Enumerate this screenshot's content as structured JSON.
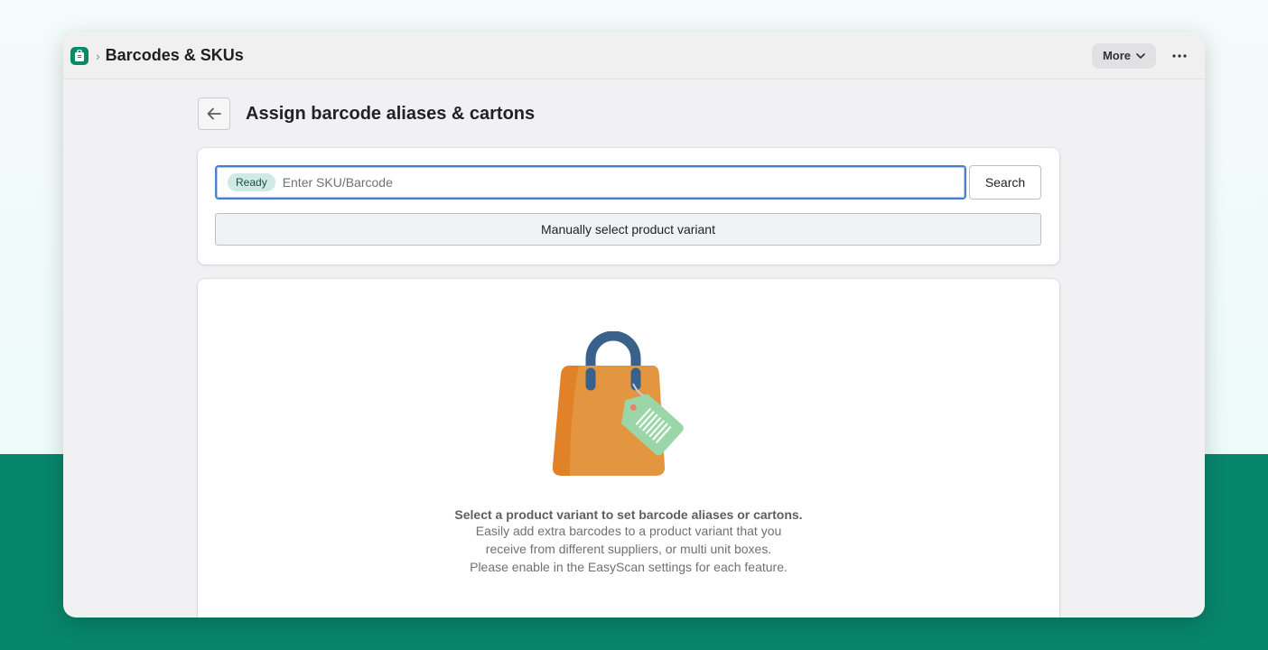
{
  "titlebar": {
    "app_title": "Barcodes & SKUs",
    "more_label": "More"
  },
  "page": {
    "title": "Assign barcode aliases & cartons"
  },
  "search": {
    "status_badge": "Ready",
    "placeholder": "Enter SKU/Barcode",
    "value": "",
    "button_label": "Search",
    "manual_select_label": "Manually select product variant"
  },
  "empty_state": {
    "heading": "Select a product variant to set barcode aliases or cartons.",
    "lines": [
      "Easily add extra barcodes to a product variant that you",
      "receive from different suppliers, or multi unit boxes.",
      "Please enable in the EasyScan settings for each feature."
    ]
  },
  "colors": {
    "brand_green": "#078a68",
    "background_band": "#07856a",
    "focus_blue": "#4a7fd0",
    "bag_orange": "#e4953f",
    "tag_green": "#9bd6a8",
    "handle_blue": "#3a6189"
  },
  "icons": {
    "app": "shopping-bag-icon",
    "breadcrumb_separator": "chevron-right-icon",
    "more_caret": "chevron-down-icon",
    "overflow": "horizontal-dots-icon",
    "back": "arrow-left-icon",
    "illustration": "shopping-bag-with-price-tag"
  }
}
